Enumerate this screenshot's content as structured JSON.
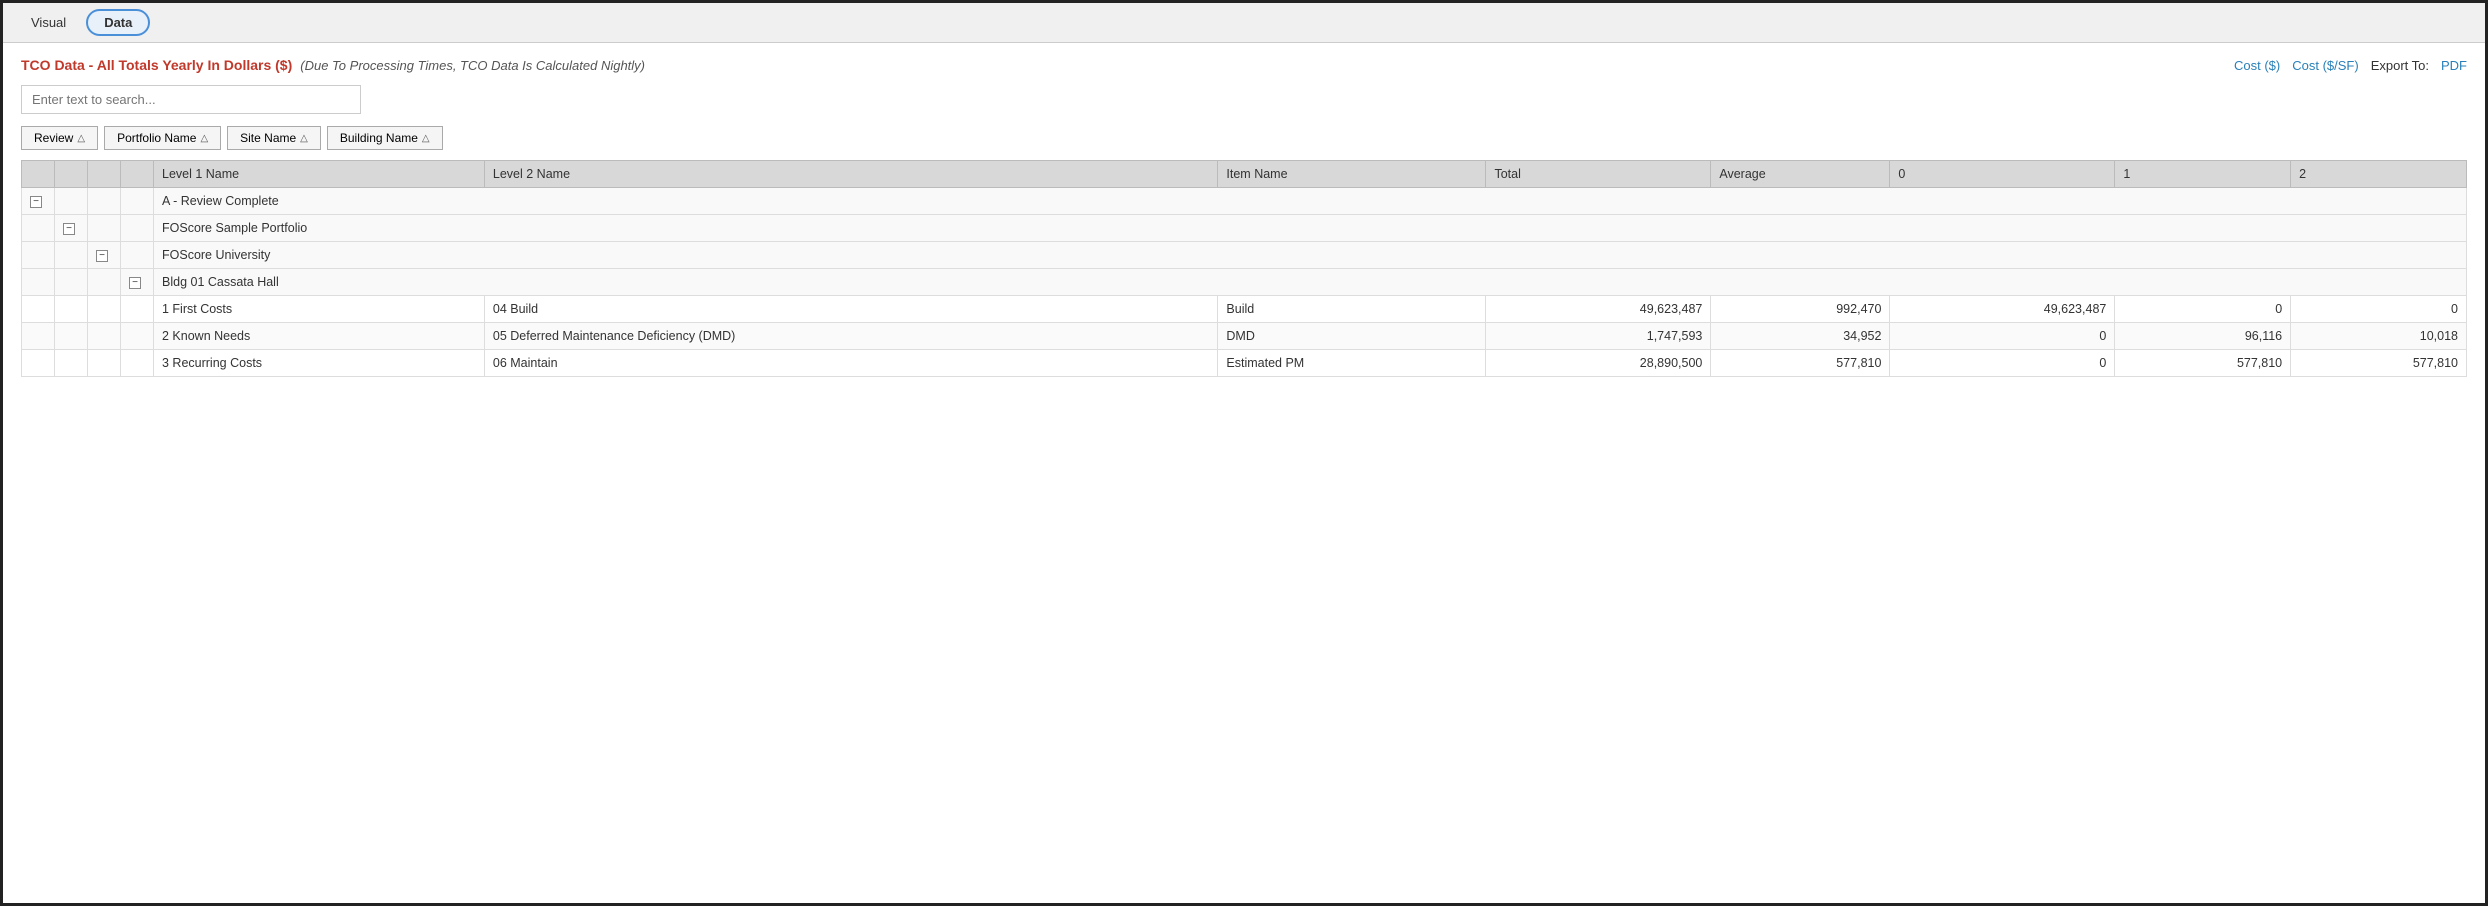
{
  "tabs": [
    {
      "label": "Visual",
      "active": false
    },
    {
      "label": "Data",
      "active": true
    }
  ],
  "header": {
    "title_bold": "TCO Data - All Totals Yearly In Dollars ($)",
    "title_italic": "(Due To Processing Times, TCO Data Is Calculated Nightly)",
    "cost_label": "Cost ($)",
    "cost_sf_label": "Cost ($/SF)",
    "export_label": "Export To:",
    "pdf_label": "PDF"
  },
  "search": {
    "placeholder": "Enter text to search..."
  },
  "sort_buttons": [
    {
      "label": "Review",
      "arrow": "△"
    },
    {
      "label": "Portfolio Name",
      "arrow": "△"
    },
    {
      "label": "Site Name",
      "arrow": "△"
    },
    {
      "label": "Building Name",
      "arrow": "△"
    }
  ],
  "table": {
    "columns": [
      {
        "label": ""
      },
      {
        "label": ""
      },
      {
        "label": ""
      },
      {
        "label": ""
      },
      {
        "label": "Level 1 Name"
      },
      {
        "label": "Level 2 Name"
      },
      {
        "label": "Item Name"
      },
      {
        "label": "Total"
      },
      {
        "label": "Average"
      },
      {
        "label": "0"
      },
      {
        "label": "1"
      },
      {
        "label": "2"
      }
    ],
    "groups": [
      {
        "type": "review",
        "label": "A - Review Complete",
        "indent": 0,
        "children": [
          {
            "type": "portfolio",
            "label": "FOScore Sample Portfolio",
            "indent": 1,
            "children": [
              {
                "type": "site",
                "label": "FOScore University",
                "indent": 2,
                "children": [
                  {
                    "type": "building",
                    "label": "Bldg 01 Cassata Hall",
                    "indent": 3,
                    "rows": [
                      {
                        "level1": "1 First Costs",
                        "level2": "04 Build",
                        "item": "Build",
                        "total": "49,623,487",
                        "average": "992,470",
                        "col0": "49,623,487",
                        "col1": "0",
                        "col2": "0"
                      },
                      {
                        "level1": "2 Known Needs",
                        "level2": "05 Deferred Maintenance Deficiency (DMD)",
                        "item": "DMD",
                        "total": "1,747,593",
                        "average": "34,952",
                        "col0": "0",
                        "col1": "96,116",
                        "col2": "10,018"
                      },
                      {
                        "level1": "3 Recurring Costs",
                        "level2": "06 Maintain",
                        "item": "Estimated PM",
                        "total": "28,890,500",
                        "average": "577,810",
                        "col0": "0",
                        "col1": "577,810",
                        "col2": "577,810"
                      }
                    ]
                  }
                ]
              }
            ]
          }
        ]
      }
    ]
  }
}
